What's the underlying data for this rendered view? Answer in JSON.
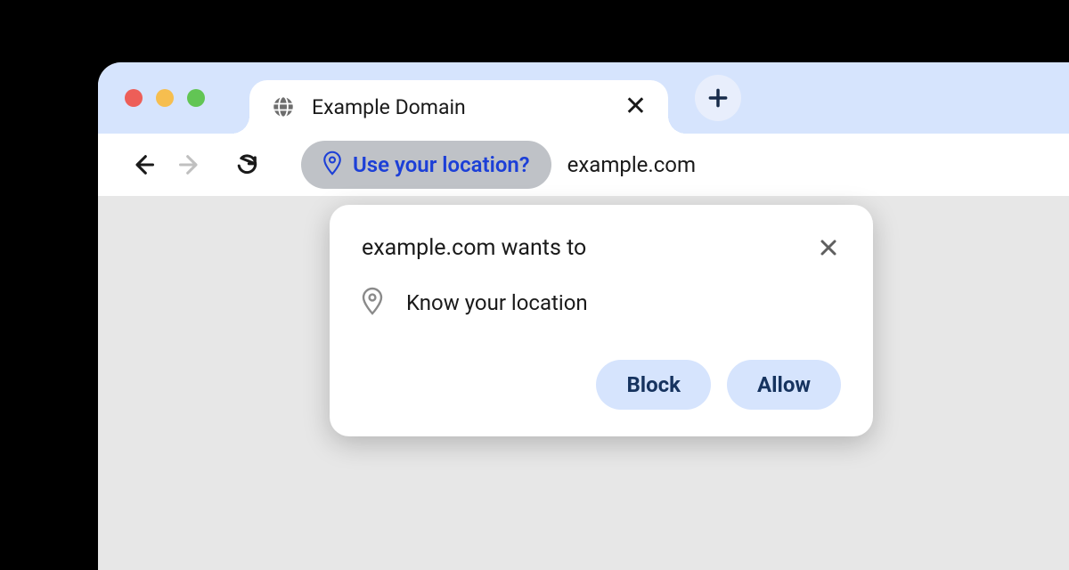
{
  "tab": {
    "title": "Example Domain"
  },
  "address": {
    "chip_text": "Use your location?",
    "url": "example.com"
  },
  "popup": {
    "title": "example.com wants to",
    "body": "Know your location",
    "block_label": "Block",
    "allow_label": "Allow"
  }
}
